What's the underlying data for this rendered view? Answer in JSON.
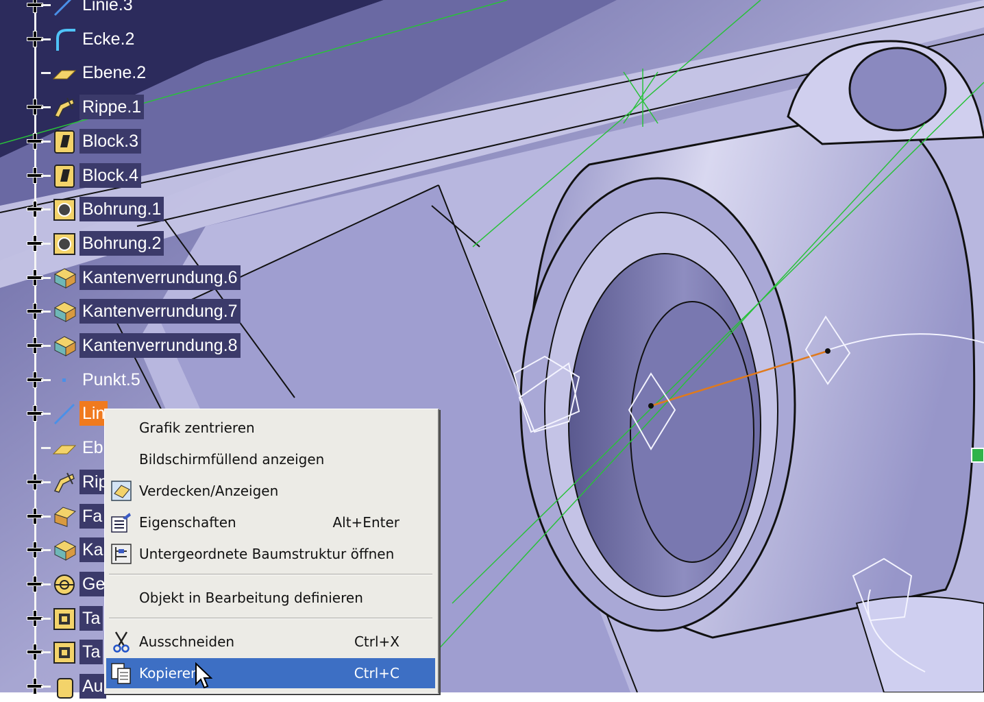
{
  "tree": {
    "items": [
      {
        "label": "Linie.3",
        "icon": "line-icon",
        "state": "normal",
        "plus": true
      },
      {
        "label": "Ecke.2",
        "icon": "corner-icon",
        "state": "normal",
        "plus": true
      },
      {
        "label": "Ebene.2",
        "icon": "plane-icon",
        "state": "normal",
        "plus": false
      },
      {
        "label": "Rippe.1",
        "icon": "rib-icon",
        "state": "selected",
        "plus": true
      },
      {
        "label": "Block.3",
        "icon": "pad-icon",
        "state": "selected",
        "plus": true
      },
      {
        "label": "Block.4",
        "icon": "pad-icon",
        "state": "selected",
        "plus": true
      },
      {
        "label": "Bohrung.1",
        "icon": "hole-icon",
        "state": "selected",
        "plus": true
      },
      {
        "label": "Bohrung.2",
        "icon": "hole-icon",
        "state": "selected",
        "plus": true
      },
      {
        "label": "Kantenverrundung.6",
        "icon": "edge-fillet-icon",
        "state": "selected",
        "plus": true
      },
      {
        "label": "Kantenverrundung.7",
        "icon": "edge-fillet-icon",
        "state": "selected",
        "plus": true
      },
      {
        "label": "Kantenverrundung.8",
        "icon": "edge-fillet-icon",
        "state": "selected",
        "plus": true
      },
      {
        "label": "Punkt.5",
        "icon": "point-icon",
        "state": "normal",
        "plus": true
      },
      {
        "label": "Lin",
        "icon": "line-icon",
        "state": "active",
        "plus": true
      },
      {
        "label": "Eb",
        "icon": "plane-icon",
        "state": "normal",
        "plus": false
      },
      {
        "label": "Rip",
        "icon": "rib-icon",
        "state": "selected",
        "plus": true
      },
      {
        "label": "Fa",
        "icon": "chamfer-icon",
        "state": "selected",
        "plus": true
      },
      {
        "label": "Ka",
        "icon": "edge-fillet-icon",
        "state": "selected",
        "plus": true
      },
      {
        "label": "Ge",
        "icon": "geometry-icon",
        "state": "selected",
        "plus": true
      },
      {
        "label": "Ta",
        "icon": "pocket-icon",
        "state": "selected",
        "plus": true
      },
      {
        "label": "Ta",
        "icon": "pocket-icon",
        "state": "selected",
        "plus": true
      },
      {
        "label": "Au",
        "icon": "solid-icon",
        "state": "selected",
        "plus": true
      }
    ]
  },
  "context_menu": {
    "items": [
      {
        "label": "Grafik zentrieren",
        "shortcut": "",
        "icon": "",
        "highlighted": false
      },
      {
        "label": "Bildschirmfüllend anzeigen",
        "shortcut": "",
        "icon": "",
        "highlighted": false
      },
      {
        "label": "Verdecken/Anzeigen",
        "shortcut": "",
        "icon": "hide-show-icon",
        "highlighted": false
      },
      {
        "label": "Eigenschaften",
        "shortcut": "Alt+Enter",
        "icon": "properties-icon",
        "highlighted": false
      },
      {
        "label": "Untergeordnete Baumstruktur öffnen",
        "shortcut": "",
        "icon": "tree-icon",
        "highlighted": false
      },
      {
        "label": "Objekt in Bearbeitung definieren",
        "shortcut": "",
        "icon": "",
        "highlighted": false
      },
      {
        "label": "Ausschneiden",
        "shortcut": "Ctrl+X",
        "icon": "scissors-icon",
        "highlighted": false
      },
      {
        "label": "Kopieren",
        "shortcut": "Ctrl+C",
        "icon": "copy-icon",
        "highlighted": true
      }
    ]
  },
  "colors": {
    "background": "#a9a8d2",
    "selection": "#3b3a6a",
    "active_item": "#f07a1e",
    "menu_highlight": "#3d6fc4",
    "construction_line": "#29c13a"
  }
}
